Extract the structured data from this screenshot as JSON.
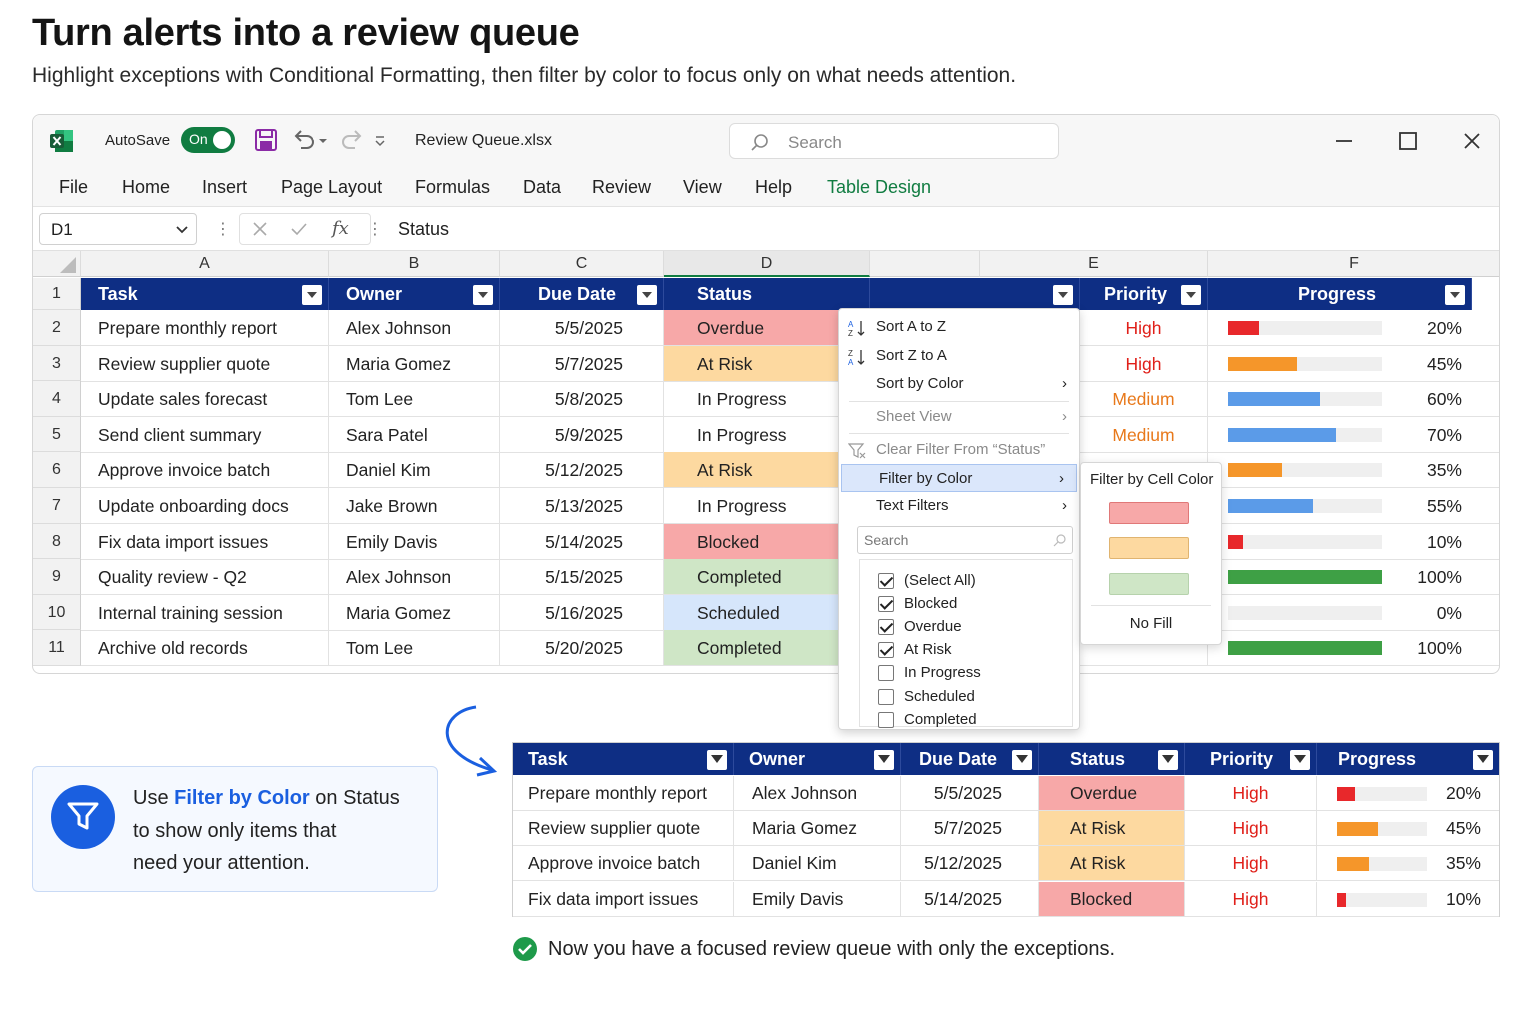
{
  "page": {
    "headline": "Turn alerts into a review queue",
    "subline": "Highlight exceptions with Conditional Formatting, then filter by color to focus only on what needs attention."
  },
  "titlebar": {
    "autosave_label": "AutoSave",
    "toggle_label": "On",
    "filename": "Review Queue.xlsx",
    "search_placeholder": "Search"
  },
  "menubar": [
    "File",
    "Home",
    "Insert",
    "Page Layout",
    "Formulas",
    "Data",
    "Review",
    "View",
    "Help",
    "Table Design"
  ],
  "formula_bar": {
    "name_box": "D1",
    "fx": "fx",
    "formula": "Status"
  },
  "columns": [
    "A",
    "B",
    "C",
    "D",
    "E",
    "F"
  ],
  "headers": [
    "Task",
    "Owner",
    "Due Date",
    "Status",
    "Priority",
    "Progress"
  ],
  "rows": [
    {
      "n": "1"
    },
    {
      "n": "2",
      "task": "Prepare monthly report",
      "owner": "Alex Johnson",
      "due": "5/5/2025",
      "status": "Overdue",
      "priority": "High",
      "progress": 0.2,
      "progress_label": "20%"
    },
    {
      "n": "3",
      "task": "Review supplier quote",
      "owner": "Maria Gomez",
      "due": "5/7/2025",
      "status": "At Risk",
      "priority": "High",
      "progress": 0.45,
      "progress_label": "45%"
    },
    {
      "n": "4",
      "task": "Update sales forecast",
      "owner": "Tom Lee",
      "due": "5/8/2025",
      "status": "In Progress",
      "priority": "Medium",
      "progress": 0.6,
      "progress_label": "60%"
    },
    {
      "n": "5",
      "task": "Send client summary",
      "owner": "Sara Patel",
      "due": "5/9/2025",
      "status": "In Progress",
      "priority": "Medium",
      "progress": 0.7,
      "progress_label": "70%"
    },
    {
      "n": "6",
      "task": "Approve invoice batch",
      "owner": "Daniel Kim",
      "due": "5/12/2025",
      "status": "At Risk",
      "priority": "",
      "progress": 0.35,
      "progress_label": "35%"
    },
    {
      "n": "7",
      "task": "Update onboarding docs",
      "owner": "Jake Brown",
      "due": "5/13/2025",
      "status": "In Progress",
      "priority": "",
      "progress": 0.55,
      "progress_label": "55%"
    },
    {
      "n": "8",
      "task": "Fix data import issues",
      "owner": "Emily Davis",
      "due": "5/14/2025",
      "status": "Blocked",
      "priority": "",
      "progress": 0.1,
      "progress_label": "10%"
    },
    {
      "n": "9",
      "task": "Quality review - Q2",
      "owner": "Alex Johnson",
      "due": "5/15/2025",
      "status": "Completed",
      "priority": "",
      "progress": 1.0,
      "progress_label": "100%"
    },
    {
      "n": "10",
      "task": "Internal training session",
      "owner": "Maria Gomez",
      "due": "5/16/2025",
      "status": "Scheduled",
      "priority": "",
      "progress": 0,
      "progress_label": "0%"
    },
    {
      "n": "11",
      "task": "Archive old records",
      "owner": "Tom Lee",
      "due": "5/20/2025",
      "status": "Completed",
      "priority": "",
      "progress": 1.0,
      "progress_label": "100%"
    }
  ],
  "context_menu": {
    "sort_az": "Sort A to Z",
    "sort_za": "Sort Z to A",
    "sort_by_color": "Sort by Color",
    "sheet_view": "Sheet View",
    "clear_filter": "Clear Filter From “Status”",
    "filter_by_color": "Filter by Color",
    "text_filters": "Text Filters",
    "search": "Search",
    "checklist": [
      {
        "label": "(Select All)",
        "checked": true
      },
      {
        "label": "Blocked",
        "checked": true
      },
      {
        "label": "Overdue",
        "checked": true
      },
      {
        "label": "At Risk",
        "checked": true
      },
      {
        "label": "In Progress",
        "checked": false
      },
      {
        "label": "Scheduled",
        "checked": false
      },
      {
        "label": "Completed",
        "checked": false
      }
    ]
  },
  "submenu": {
    "title": "Filter by Cell Color",
    "swatches": [
      "#f7a8a8",
      "#fdd9a0",
      "#cfe6c6"
    ],
    "no_fill": "No Fill"
  },
  "tip": {
    "pre": "Use ",
    "highlight": "Filter by Color",
    "post": " on Status",
    "line2": "to show only items that",
    "line3": "need your attention."
  },
  "result_table": {
    "headers": [
      "Task",
      "Owner",
      "Due Date",
      "Status",
      "Priority",
      "Progress"
    ],
    "rows": [
      {
        "task": "Prepare monthly report",
        "owner": "Alex Johnson",
        "due": "5/5/2025",
        "status": "Overdue",
        "priority": "High",
        "progress": 0.2,
        "progress_label": "20%"
      },
      {
        "task": "Review supplier quote",
        "owner": "Maria Gomez",
        "due": "5/7/2025",
        "status": "At Risk",
        "priority": "High",
        "progress": 0.45,
        "progress_label": "45%"
      },
      {
        "task": "Approve invoice batch",
        "owner": "Daniel Kim",
        "due": "5/12/2025",
        "status": "At Risk",
        "priority": "High",
        "progress": 0.35,
        "progress_label": "35%"
      },
      {
        "task": "Fix data import issues",
        "owner": "Emily Davis",
        "due": "5/14/2025",
        "status": "Blocked",
        "priority": "High",
        "progress": 0.1,
        "progress_label": "10%"
      }
    ]
  },
  "done_message": "Now you have a focused review queue with only the exceptions.",
  "colors": {
    "header_navy": "#0e2e84",
    "excel_green": "#107c41",
    "accent_blue": "#1a5fe0",
    "status_overdue": "#f7a8a8",
    "status_atrisk": "#fdd9a0",
    "status_blocked": "#f7a8a8",
    "status_completed": "#cfe6c6",
    "status_scheduled": "#d6e6fb",
    "priority_high": "#e0201a",
    "priority_medium": "#e8781a",
    "bar_red": "#e8282b",
    "bar_orange": "#f5962a",
    "bar_blue": "#5b9be8",
    "bar_green": "#3ea045"
  },
  "icons": [
    "excel-logo-icon",
    "save-icon",
    "undo-icon",
    "redo-icon",
    "search-icon",
    "minimize-icon",
    "maximize-icon",
    "close-icon",
    "filter-funnel-icon",
    "curved-arrow-icon",
    "check-circle-icon"
  ]
}
